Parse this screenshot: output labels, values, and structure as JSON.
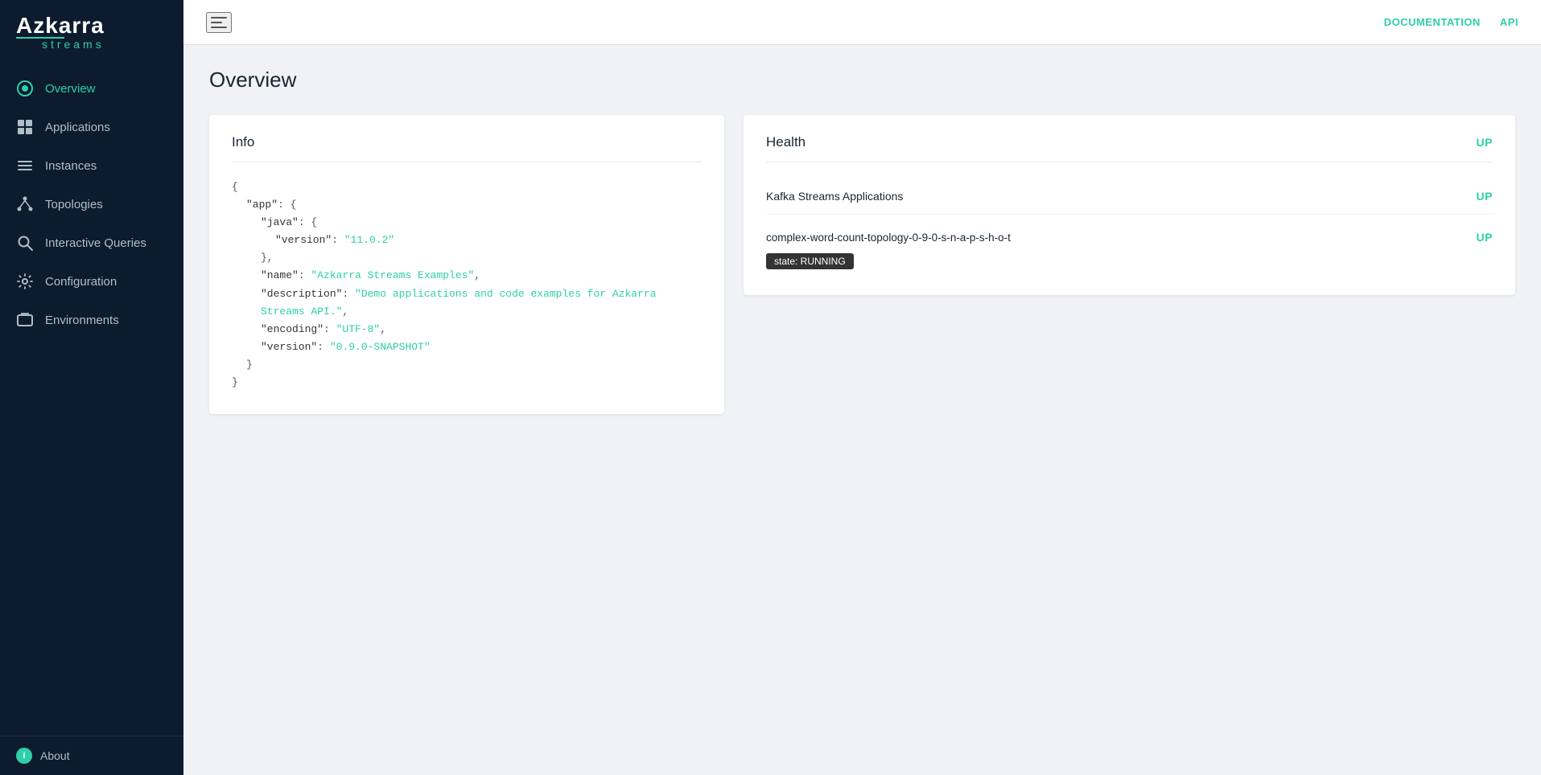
{
  "brand": {
    "name": "Azkarra",
    "subtitle": "streams"
  },
  "topbar": {
    "documentation_label": "DOCUMENTATION",
    "api_label": "API"
  },
  "sidebar": {
    "items": [
      {
        "id": "overview",
        "label": "Overview",
        "active": true
      },
      {
        "id": "applications",
        "label": "Applications",
        "active": false
      },
      {
        "id": "instances",
        "label": "Instances",
        "active": false
      },
      {
        "id": "topologies",
        "label": "Topologies",
        "active": false
      },
      {
        "id": "interactive-queries",
        "label": "Interactive Queries",
        "active": false
      },
      {
        "id": "configuration",
        "label": "Configuration",
        "active": false
      },
      {
        "id": "environments",
        "label": "Environments",
        "active": false
      }
    ],
    "footer": {
      "label": "About"
    }
  },
  "page": {
    "title": "Overview"
  },
  "info_card": {
    "title": "Info",
    "json_lines": [
      {
        "indent": 0,
        "text": "{"
      },
      {
        "indent": 1,
        "key": "\"app\"",
        "sep": ": {"
      },
      {
        "indent": 2,
        "key": "\"java\"",
        "sep": ": {"
      },
      {
        "indent": 3,
        "key": "\"version\"",
        "sep": ": ",
        "value": "\"11.0.2\""
      },
      {
        "indent": 2,
        "text": "},"
      },
      {
        "indent": 2,
        "key": "\"name\"",
        "sep": ": ",
        "value": "\"Azkarra Streams Examples\"",
        "comma": ","
      },
      {
        "indent": 2,
        "key": "\"description\"",
        "sep": ": ",
        "value": "\"Demo applications and code examples for Azkarra Streams API.\"",
        "comma": ","
      },
      {
        "indent": 2,
        "key": "\"encoding\"",
        "sep": ": ",
        "value": "\"UTF-8\"",
        "comma": ","
      },
      {
        "indent": 2,
        "key": "\"version\"",
        "sep": ": ",
        "value": "\"0.9.0-SNAPSHOT\""
      },
      {
        "indent": 1,
        "text": "}"
      },
      {
        "indent": 0,
        "text": "}"
      }
    ]
  },
  "health_card": {
    "title": "Health",
    "status": "UP",
    "kafka_row": {
      "name": "Kafka Streams Applications",
      "status": "UP"
    },
    "topology": {
      "name": "complex-word-count-topology-0-9-0-s-n-a-p-s-h-o-t",
      "status": "UP",
      "state_badge": "state: RUNNING"
    }
  }
}
